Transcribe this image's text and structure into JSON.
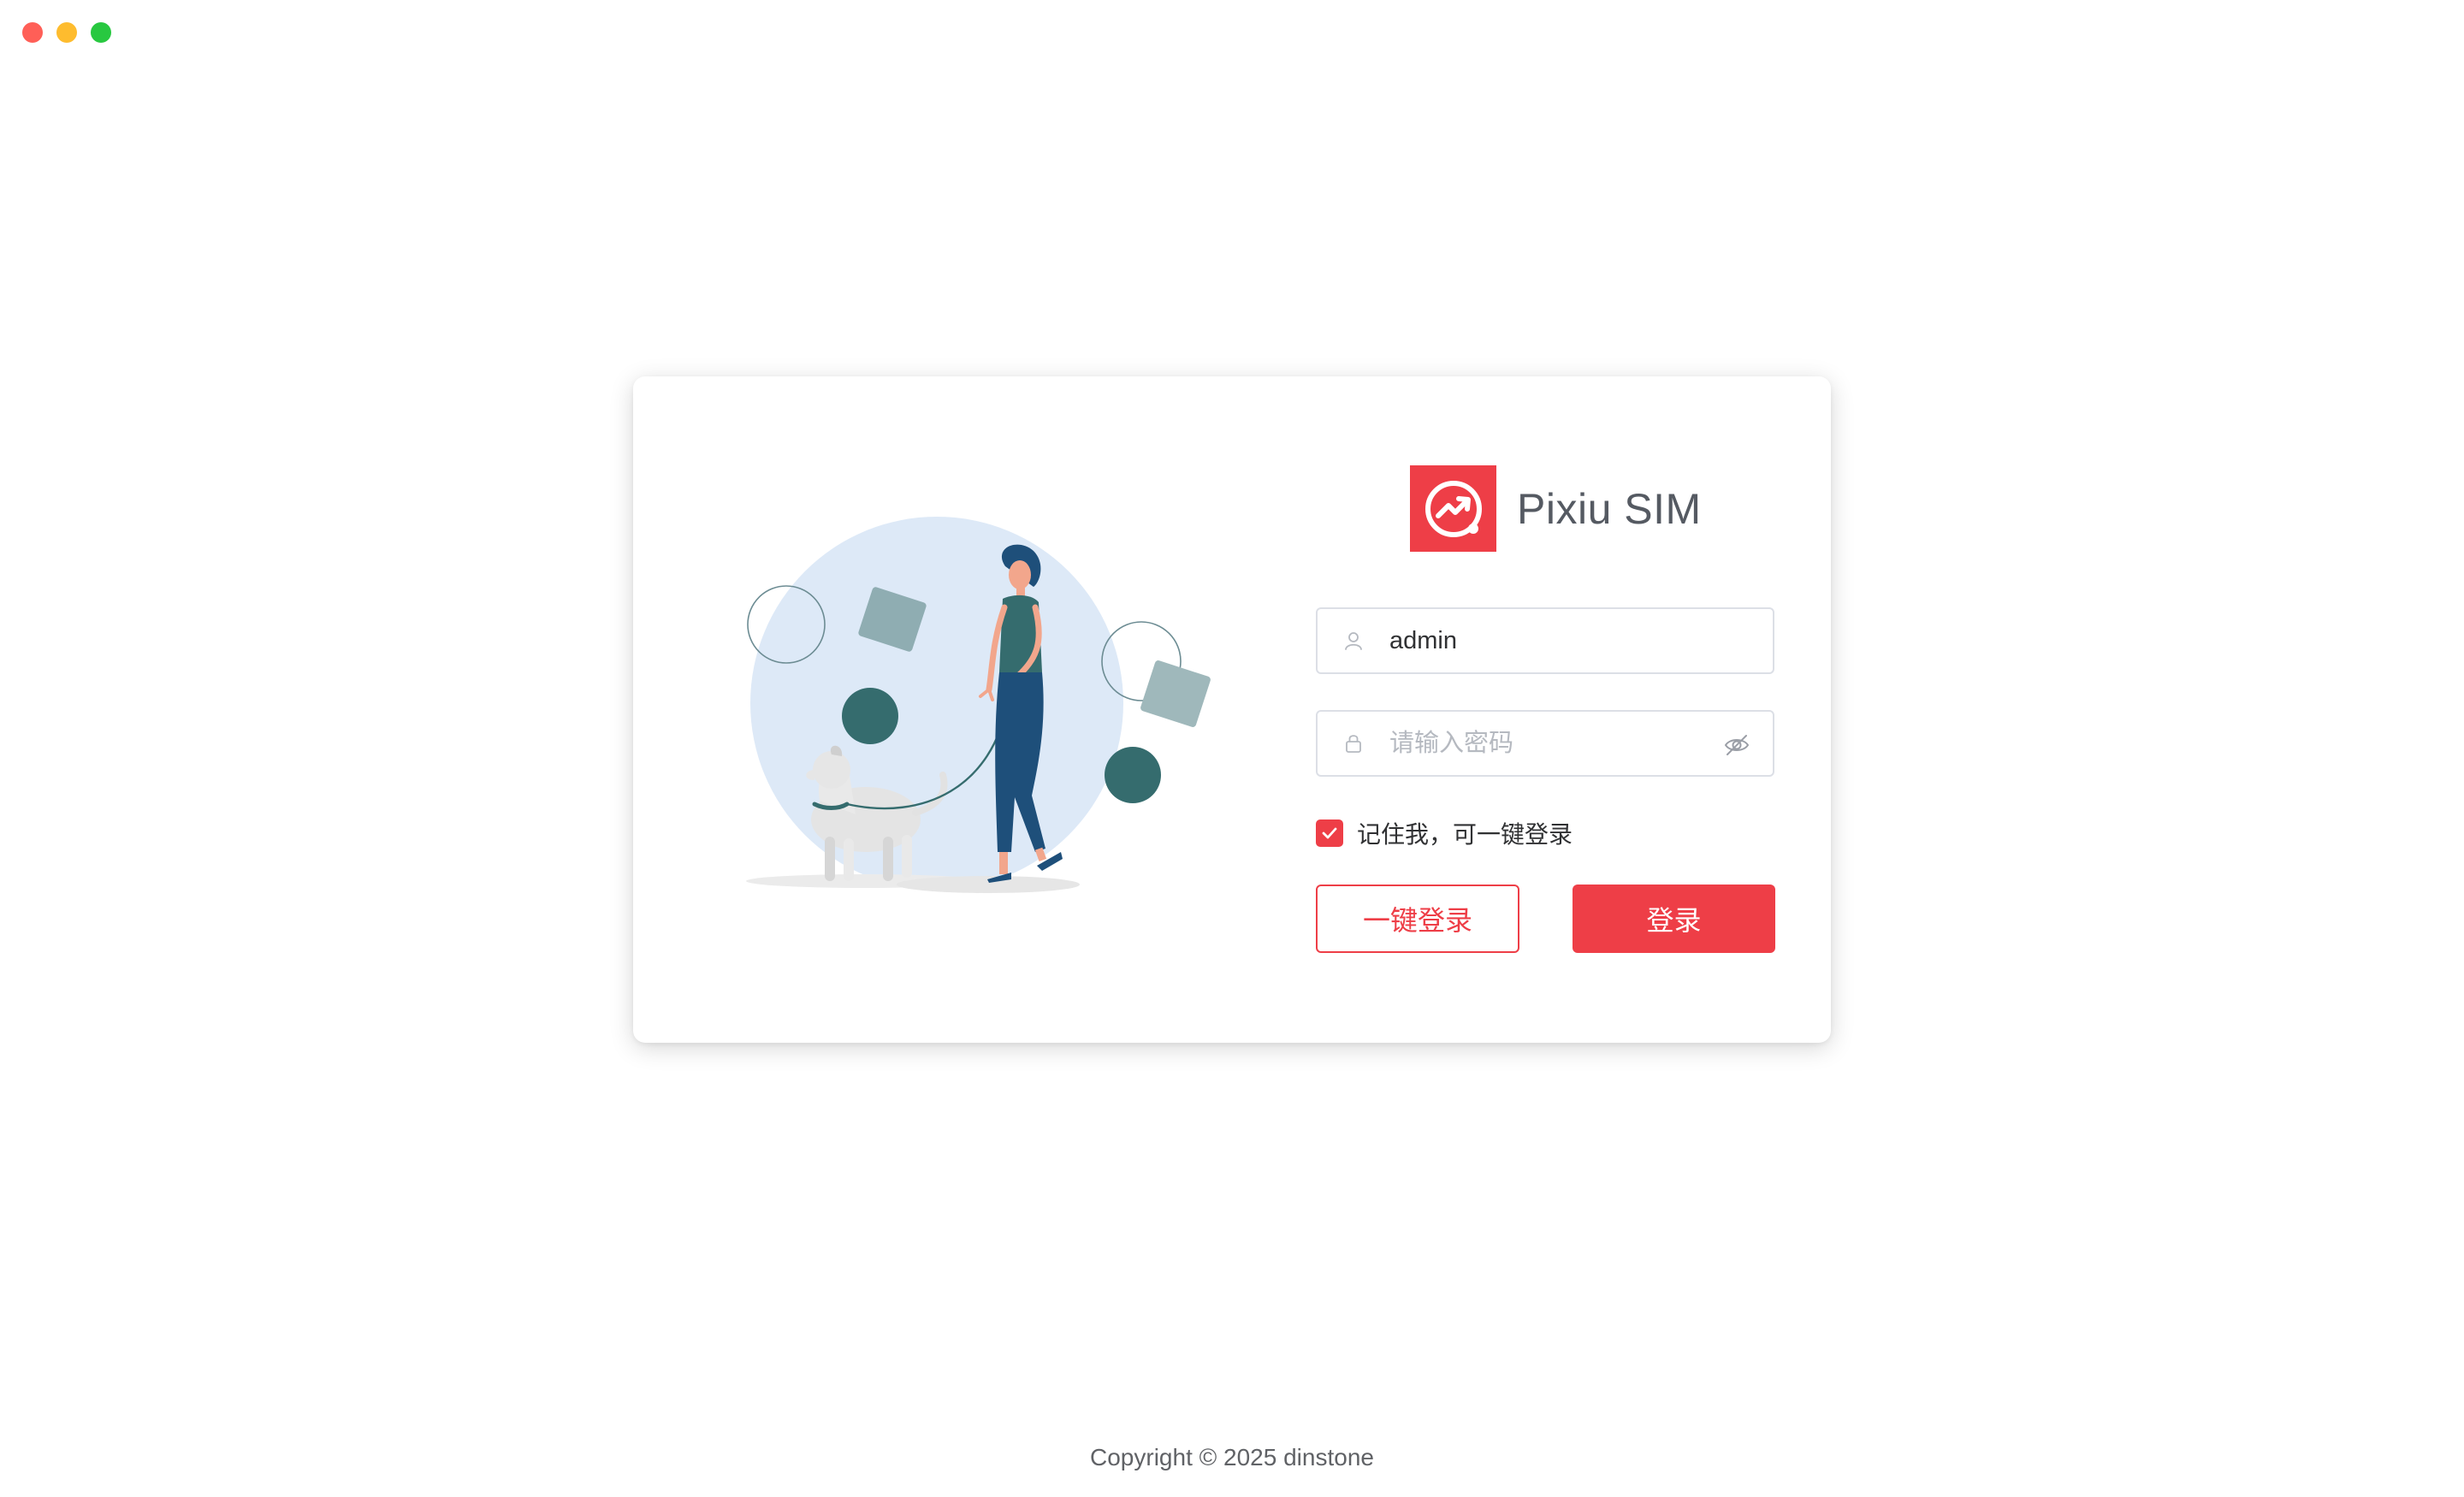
{
  "app": {
    "name": "Pixiu SIM",
    "brand_color": "#ee3e47"
  },
  "window_controls": {
    "close_color": "#ff5f57",
    "minimize_color": "#febc2e",
    "maximize_color": "#28c840"
  },
  "login": {
    "username_value": "admin",
    "password_placeholder": "请输入密码",
    "remember_label": "记住我，可一键登录",
    "remember_checked": true,
    "quick_login_label": "一键登录",
    "login_label": "登录"
  },
  "icons": {
    "username": "user-icon",
    "password": "lock-icon",
    "toggle_password": "eye-slash-icon",
    "logo": "trend-chart-icon",
    "checkbox": "check-icon"
  },
  "footer": {
    "copyright": "Copyright © 2025 dinstone"
  }
}
